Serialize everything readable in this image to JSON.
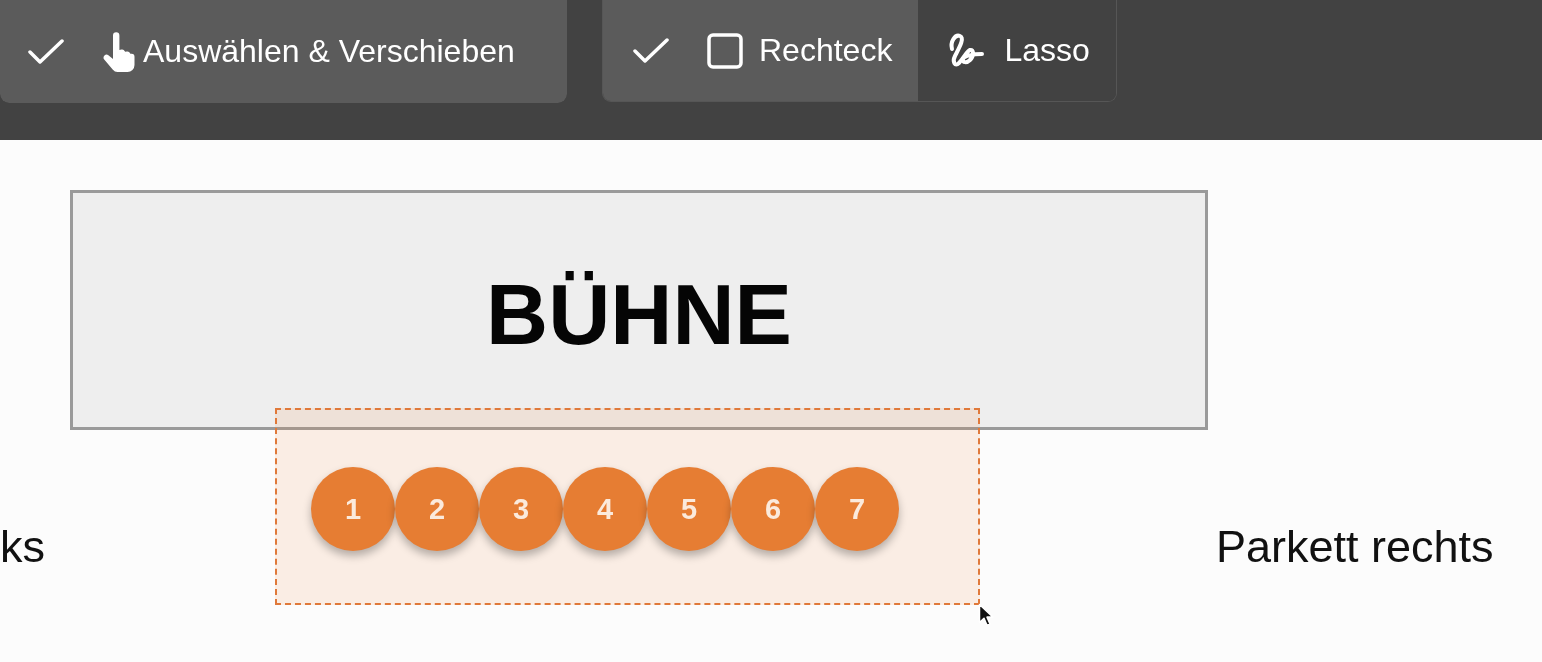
{
  "toolbar": {
    "groups": [
      {
        "items": [
          {
            "kind": "move",
            "label": "Auswählen & Verschieben",
            "selected": true
          }
        ]
      },
      {
        "items": [
          {
            "kind": "rectangle",
            "label": "Rechteck",
            "selected": true
          },
          {
            "kind": "lasso",
            "label": "Lasso",
            "selected": false
          }
        ]
      }
    ]
  },
  "canvas": {
    "stage": {
      "label": "BÜHNE"
    },
    "seats": [
      {
        "label": "1"
      },
      {
        "label": "2"
      },
      {
        "label": "3"
      },
      {
        "label": "4"
      },
      {
        "label": "5"
      },
      {
        "label": "6"
      },
      {
        "label": "7"
      }
    ],
    "sections": [
      {
        "kind": "left",
        "label": "ks"
      },
      {
        "kind": "right",
        "label": "Parkett rechts"
      }
    ]
  }
}
